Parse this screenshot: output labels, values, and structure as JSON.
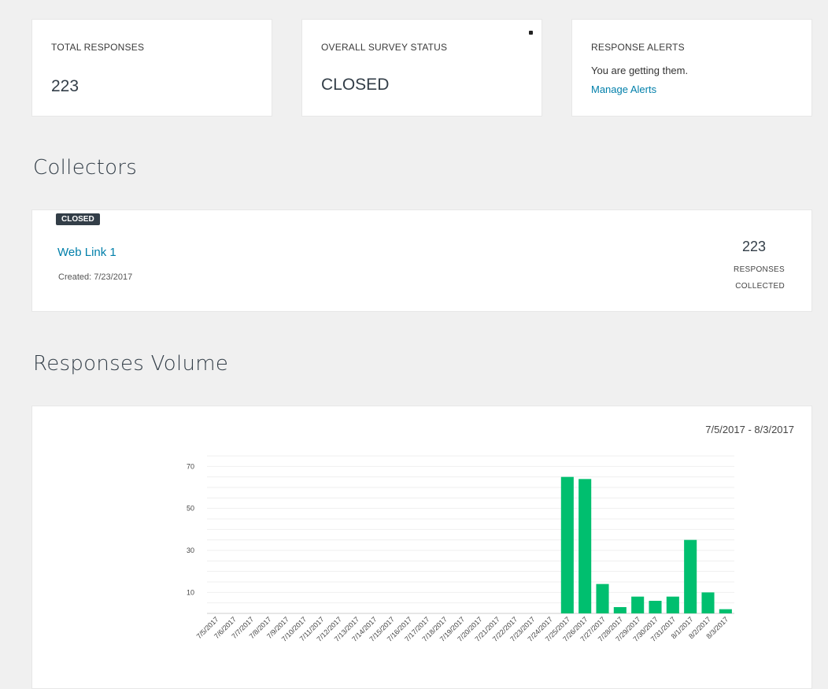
{
  "summary": {
    "total_responses": {
      "label": "TOTAL RESPONSES",
      "value": "223"
    },
    "survey_status": {
      "label": "OVERALL SURVEY STATUS",
      "value": "CLOSED"
    },
    "response_alerts": {
      "label": "RESPONSE ALERTS",
      "text": "You are getting them.",
      "link": "Manage Alerts"
    }
  },
  "collectors": {
    "title": "Collectors",
    "items": [
      {
        "status": "CLOSED",
        "name": "Web Link 1",
        "created": "Created: 7/23/2017",
        "count": "223",
        "count_label_1": "RESPONSES",
        "count_label_2": "COLLECTED"
      }
    ]
  },
  "volume": {
    "title": "Responses Volume",
    "date_range": "7/5/2017 - 8/3/2017"
  },
  "colors": {
    "bar": "#00bf6f",
    "link": "#007faa",
    "badge": "#333e48"
  },
  "chart_data": {
    "type": "bar",
    "categories": [
      "7/5/2017",
      "7/6/2017",
      "7/7/2017",
      "7/8/2017",
      "7/9/2017",
      "7/10/2017",
      "7/11/2017",
      "7/12/2017",
      "7/13/2017",
      "7/14/2017",
      "7/15/2017",
      "7/16/2017",
      "7/17/2017",
      "7/18/2017",
      "7/19/2017",
      "7/20/2017",
      "7/21/2017",
      "7/22/2017",
      "7/23/2017",
      "7/24/2017",
      "7/25/2017",
      "7/26/2017",
      "7/27/2017",
      "7/28/2017",
      "7/29/2017",
      "7/30/2017",
      "7/31/2017",
      "8/1/2017",
      "8/2/2017",
      "8/3/2017"
    ],
    "values": [
      0,
      0,
      0,
      0,
      0,
      0,
      0,
      0,
      0,
      0,
      0,
      0,
      0,
      0,
      0,
      0,
      0,
      0,
      0,
      0,
      65,
      64,
      14,
      3,
      8,
      6,
      8,
      35,
      10,
      2
    ],
    "yticks": [
      10,
      30,
      50,
      70
    ],
    "ylim": [
      0,
      75
    ],
    "grid": true
  }
}
